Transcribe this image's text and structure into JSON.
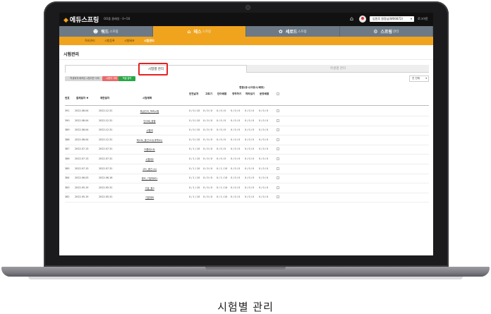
{
  "header": {
    "logo": "에듀스프링",
    "welcome": "OO을 클래일 - 0~50",
    "user_select": "임원후 원장님(W00872)",
    "logout": "로그아웃"
  },
  "nav": [
    {
      "icon": "☻",
      "label": "워드",
      "sub": "스프링",
      "active": false
    },
    {
      "icon": "⌂",
      "label": "테스",
      "sub": "스프링",
      "active": true
    },
    {
      "icon": "✿",
      "label": "세로드",
      "sub": "스프링",
      "active": false
    },
    {
      "icon": "⚙",
      "label": "스프링",
      "sub": "관리",
      "active": false
    }
  ],
  "subnav": {
    "items": [
      "직외관리",
      "시험등록",
      "시험배포",
      "시험관리"
    ]
  },
  "page_title": "시험관리",
  "tabs": {
    "active": "시험별 관리",
    "inactive": "학생별 관리"
  },
  "actions": {
    "gray": "학생에게 배포된 시험지만 삭제",
    "red": "시험지 삭제",
    "green": "엑셀 출력",
    "sort": "전 전체"
  },
  "table": {
    "group_header": "현황(응시/미응시/배포)",
    "headers": [
      "번호",
      "출제일자 ▼",
      "제한일자",
      "시험제목",
      "반전날개",
      "고르기",
      "단어배열",
      "영작하기",
      "따라읽기",
      "문장배열"
    ],
    "rows": [
      {
        "no": "391",
        "date": "2022.08.04",
        "limit": "2022.12.31",
        "title": "특급인지_학력시험",
        "c1": "0 / 0 / 10",
        "c2": "0 / 0 / 0",
        "c3": "0 / 0 / 0",
        "c4": "0 / 0 / 0",
        "c5": "0 / 0 / 0",
        "c6": "0 / 0 / 0"
      },
      {
        "no": "390",
        "date": "2022.08.04",
        "limit": "2022.12.31",
        "title": "단어테_종합",
        "c1": "0 / 0 / 10",
        "c2": "0 / 0 / 0",
        "c3": "0 / 0 / 0",
        "c4": "0 / 0 / 0",
        "c5": "0 / 0 / 0",
        "c6": "0 / 0 / 0"
      },
      {
        "no": "389",
        "date": "2022.08.04",
        "limit": "2022.12.31",
        "title": "시험테",
        "c1": "0 / 0 / 10",
        "c2": "0 / 0 / 0",
        "c3": "0 / 0 / 0",
        "c4": "0 / 0 / 0",
        "c5": "0 / 0 / 0",
        "c6": "0 / 0 / 0"
      },
      {
        "no": "388",
        "date": "2022.08.04",
        "limit": "2022.12.31",
        "title": "텍스트_중간고사(과학01)",
        "c1": "0 / 0 / 10",
        "c2": "0 / 0 / 0",
        "c3": "0 / 0 / 0",
        "c4": "0 / 0 / 0",
        "c5": "0 / 0 / 0",
        "c6": "0 / 0 / 0"
      },
      {
        "no": "387",
        "date": "2022.07.13",
        "limit": "2022.07.31",
        "title": "드롭테스트",
        "c1": "0 / 1 / 10",
        "c2": "0 / 0 / 0",
        "c3": "0 / 0 / 0",
        "c4": "0 / 0 / 0",
        "c5": "0 / 0 / 0",
        "c6": "0 / 0 / 0"
      },
      {
        "no": "386",
        "date": "2022.07.13",
        "limit": "2022.07.31",
        "title": "시험테2",
        "c1": "0 / 1 / 10",
        "c2": "0 / 0 / 0",
        "c3": "0 / 0 / 0",
        "c4": "0 / 0 / 0",
        "c5": "0 / 0 / 0",
        "c6": "0 / 0 / 0"
      },
      {
        "no": "385",
        "date": "2022.07.13",
        "limit": "2022.07.31",
        "title": "고드_중간 (4)",
        "c1": "0 / 1 / 10",
        "c2": "0 / 0 / 0",
        "c3": "0 / 1 / 10",
        "c4": "0 / 0 / 0",
        "c5": "0 / 0 / 0",
        "c6": "0 / 0 / 0"
      },
      {
        "no": "384",
        "date": "2022.06.03",
        "limit": "2022.06.16",
        "title": "중도_기말대비1",
        "c1": "0 / 1 / 10",
        "c2": "0 / 0 / 0",
        "c3": "0 / 1 / 10",
        "c4": "0 / 0 / 0",
        "c5": "0 / 0 / 0",
        "c6": "0 / 0 / 0"
      },
      {
        "no": "383",
        "date": "2022.05.19",
        "limit": "2022.05.31",
        "title": "기말_봉3",
        "c1": "0 / 1 / 10",
        "c2": "0 / 0 / 0",
        "c3": "0 / 1 / 10",
        "c4": "0 / 0 / 0",
        "c5": "0 / 0 / 0",
        "c6": "0 / 0 / 0"
      },
      {
        "no": "382",
        "date": "2022.05.19",
        "limit": "2022.05.31",
        "title": "기말대비",
        "c1": "0 / 1 / 10",
        "c2": "0 / 0 / 0",
        "c3": "0 / 1 / 10",
        "c4": "0 / 0 / 0",
        "c5": "0 / 0 / 0",
        "c6": "0 / 0 / 0"
      }
    ]
  },
  "caption": "시험별 관리"
}
